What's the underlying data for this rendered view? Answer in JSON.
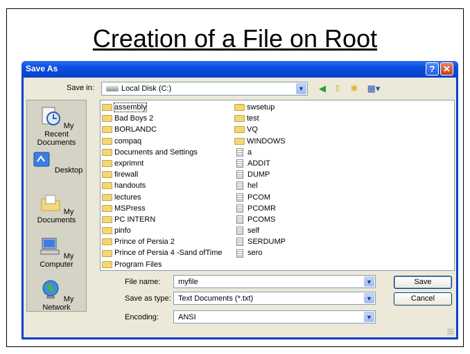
{
  "slide": {
    "title": "Creation of a File on Root"
  },
  "dialog": {
    "title": "Save As",
    "help_symbol": "?",
    "close_symbol": "✕",
    "save_in": {
      "label": "Save in:",
      "value": "Local Disk (C:)"
    },
    "toolbar_icons": [
      "back-icon",
      "up-folder-icon",
      "new-folder-icon",
      "views-menu-icon"
    ],
    "places": [
      {
        "label": "My Recent Documents",
        "icon": "recent-documents-icon"
      },
      {
        "label": "Desktop",
        "icon": "desktop-icon"
      },
      {
        "label": "My Documents",
        "icon": "my-documents-icon"
      },
      {
        "label": "My Computer",
        "icon": "my-computer-icon"
      },
      {
        "label": "My Network",
        "icon": "my-network-icon"
      }
    ],
    "files_col1": [
      {
        "name": "assembly",
        "type": "folder"
      },
      {
        "name": "Bad Boys 2",
        "type": "folder"
      },
      {
        "name": "BORLANDC",
        "type": "folder"
      },
      {
        "name": "compaq",
        "type": "folder"
      },
      {
        "name": "Documents and Settings",
        "type": "folder"
      },
      {
        "name": "exprimnt",
        "type": "folder"
      },
      {
        "name": "firewall",
        "type": "folder"
      },
      {
        "name": "handouts",
        "type": "folder"
      },
      {
        "name": "lectures",
        "type": "folder"
      },
      {
        "name": "MSPress",
        "type": "folder"
      },
      {
        "name": "PC INTERN",
        "type": "folder"
      },
      {
        "name": "pinfo",
        "type": "folder"
      },
      {
        "name": "Prince of Persia 2",
        "type": "folder"
      },
      {
        "name": "Prince of Persia 4 -Sand ofTime",
        "type": "folder"
      },
      {
        "name": "Program Files",
        "type": "folder"
      }
    ],
    "files_col2": [
      {
        "name": "swsetup",
        "type": "folder"
      },
      {
        "name": "test",
        "type": "folder"
      },
      {
        "name": "VQ",
        "type": "folder"
      },
      {
        "name": "WINDOWS",
        "type": "folder"
      },
      {
        "name": "a",
        "type": "file"
      },
      {
        "name": "ADDIT",
        "type": "file"
      },
      {
        "name": "DUMP",
        "type": "file"
      },
      {
        "name": "hel",
        "type": "file"
      },
      {
        "name": "PCOM",
        "type": "file"
      },
      {
        "name": "PCOMR",
        "type": "file"
      },
      {
        "name": "PCOMS",
        "type": "file"
      },
      {
        "name": "self",
        "type": "file"
      },
      {
        "name": "SERDUMP",
        "type": "file"
      },
      {
        "name": "sero",
        "type": "file"
      }
    ],
    "file_name": {
      "label": "File name:",
      "value": "myfile"
    },
    "save_as_type": {
      "label": "Save as type:",
      "value": "Text Documents (*.txt)"
    },
    "encoding": {
      "label": "Encoding:",
      "value": "ANSI"
    },
    "buttons": {
      "save": "Save",
      "cancel": "Cancel"
    },
    "colors": {
      "titlebar": "#0b4ee0",
      "client": "#ece9d8",
      "close": "#c3401f"
    }
  }
}
